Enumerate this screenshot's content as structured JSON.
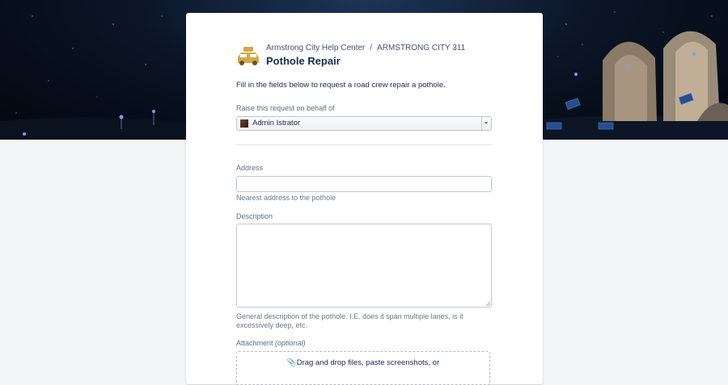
{
  "breadcrumb": {
    "help_center": "Armstrong City Help Center",
    "separator": "/",
    "service_desk": "ARMSTRONG CITY 311"
  },
  "request": {
    "title": "Pothole Repair",
    "intro": "Fill in the fields below to request a road crew repair a pothole.",
    "icon": "taxi-car-icon",
    "icon_color": "#d4a94a"
  },
  "on_behalf": {
    "label": "Raise this request on behalf of",
    "selected": "Admin Istrator"
  },
  "address": {
    "label": "Address",
    "value": "",
    "help": "Nearest address to the pothole"
  },
  "description": {
    "label": "Description",
    "value": "",
    "help": "General description of the pothole. I.E. does it span multiple lanes, is it excessively deep, etc."
  },
  "attachment": {
    "label": "Attachment",
    "optional": "(optional)",
    "dropzone_text": "Drag and drop files, paste screenshots, or"
  },
  "colors": {
    "link": "#42526e",
    "text": "#172b4d",
    "page_bg": "#f4f5f7"
  }
}
